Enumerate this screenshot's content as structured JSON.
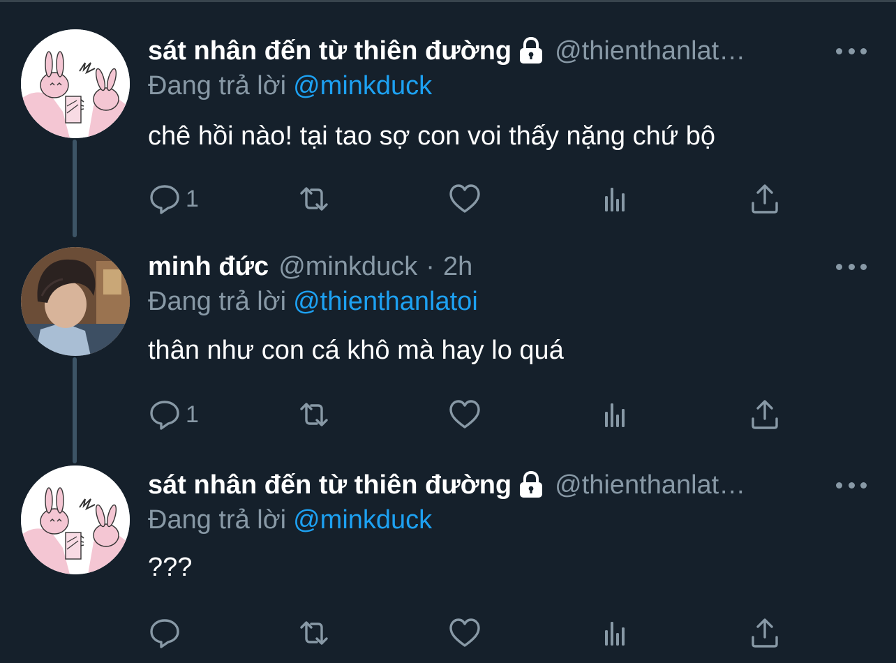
{
  "colors": {
    "background": "#15202b",
    "text_primary": "#ffffff",
    "text_secondary": "#8899a6",
    "link": "#1da1f2",
    "thread_line": "#3d5466"
  },
  "tweets": [
    {
      "name": "sát nhân đến từ thiên đường",
      "handle": "@thienthanlat…",
      "protected": true,
      "reply_prefix": "Đang trả lời",
      "reply_to": "@minkduck",
      "text": "chê hồi nào! tại tao sợ con voi thấy nặng chứ bộ",
      "reply_count": "1",
      "icons": [
        "reply-icon",
        "retweet-icon",
        "like-icon",
        "analytics-icon",
        "share-icon"
      ]
    },
    {
      "name": "minh đức",
      "handle": "@minkduck",
      "separator": "·",
      "time": "2h",
      "protected": false,
      "reply_prefix": "Đang trả lời",
      "reply_to": "@thienthanlatoi",
      "text": "thân như con cá khô mà hay lo quá",
      "reply_count": "1",
      "icons": [
        "reply-icon",
        "retweet-icon",
        "like-icon",
        "analytics-icon",
        "share-icon"
      ]
    },
    {
      "name": "sát nhân đến từ thiên đường",
      "handle": "@thienthanlat…",
      "protected": true,
      "reply_prefix": "Đang trả lời",
      "reply_to": "@minkduck",
      "text": "???",
      "reply_count": "",
      "icons": [
        "reply-icon",
        "retweet-icon",
        "like-icon",
        "analytics-icon",
        "share-icon"
      ]
    }
  ]
}
